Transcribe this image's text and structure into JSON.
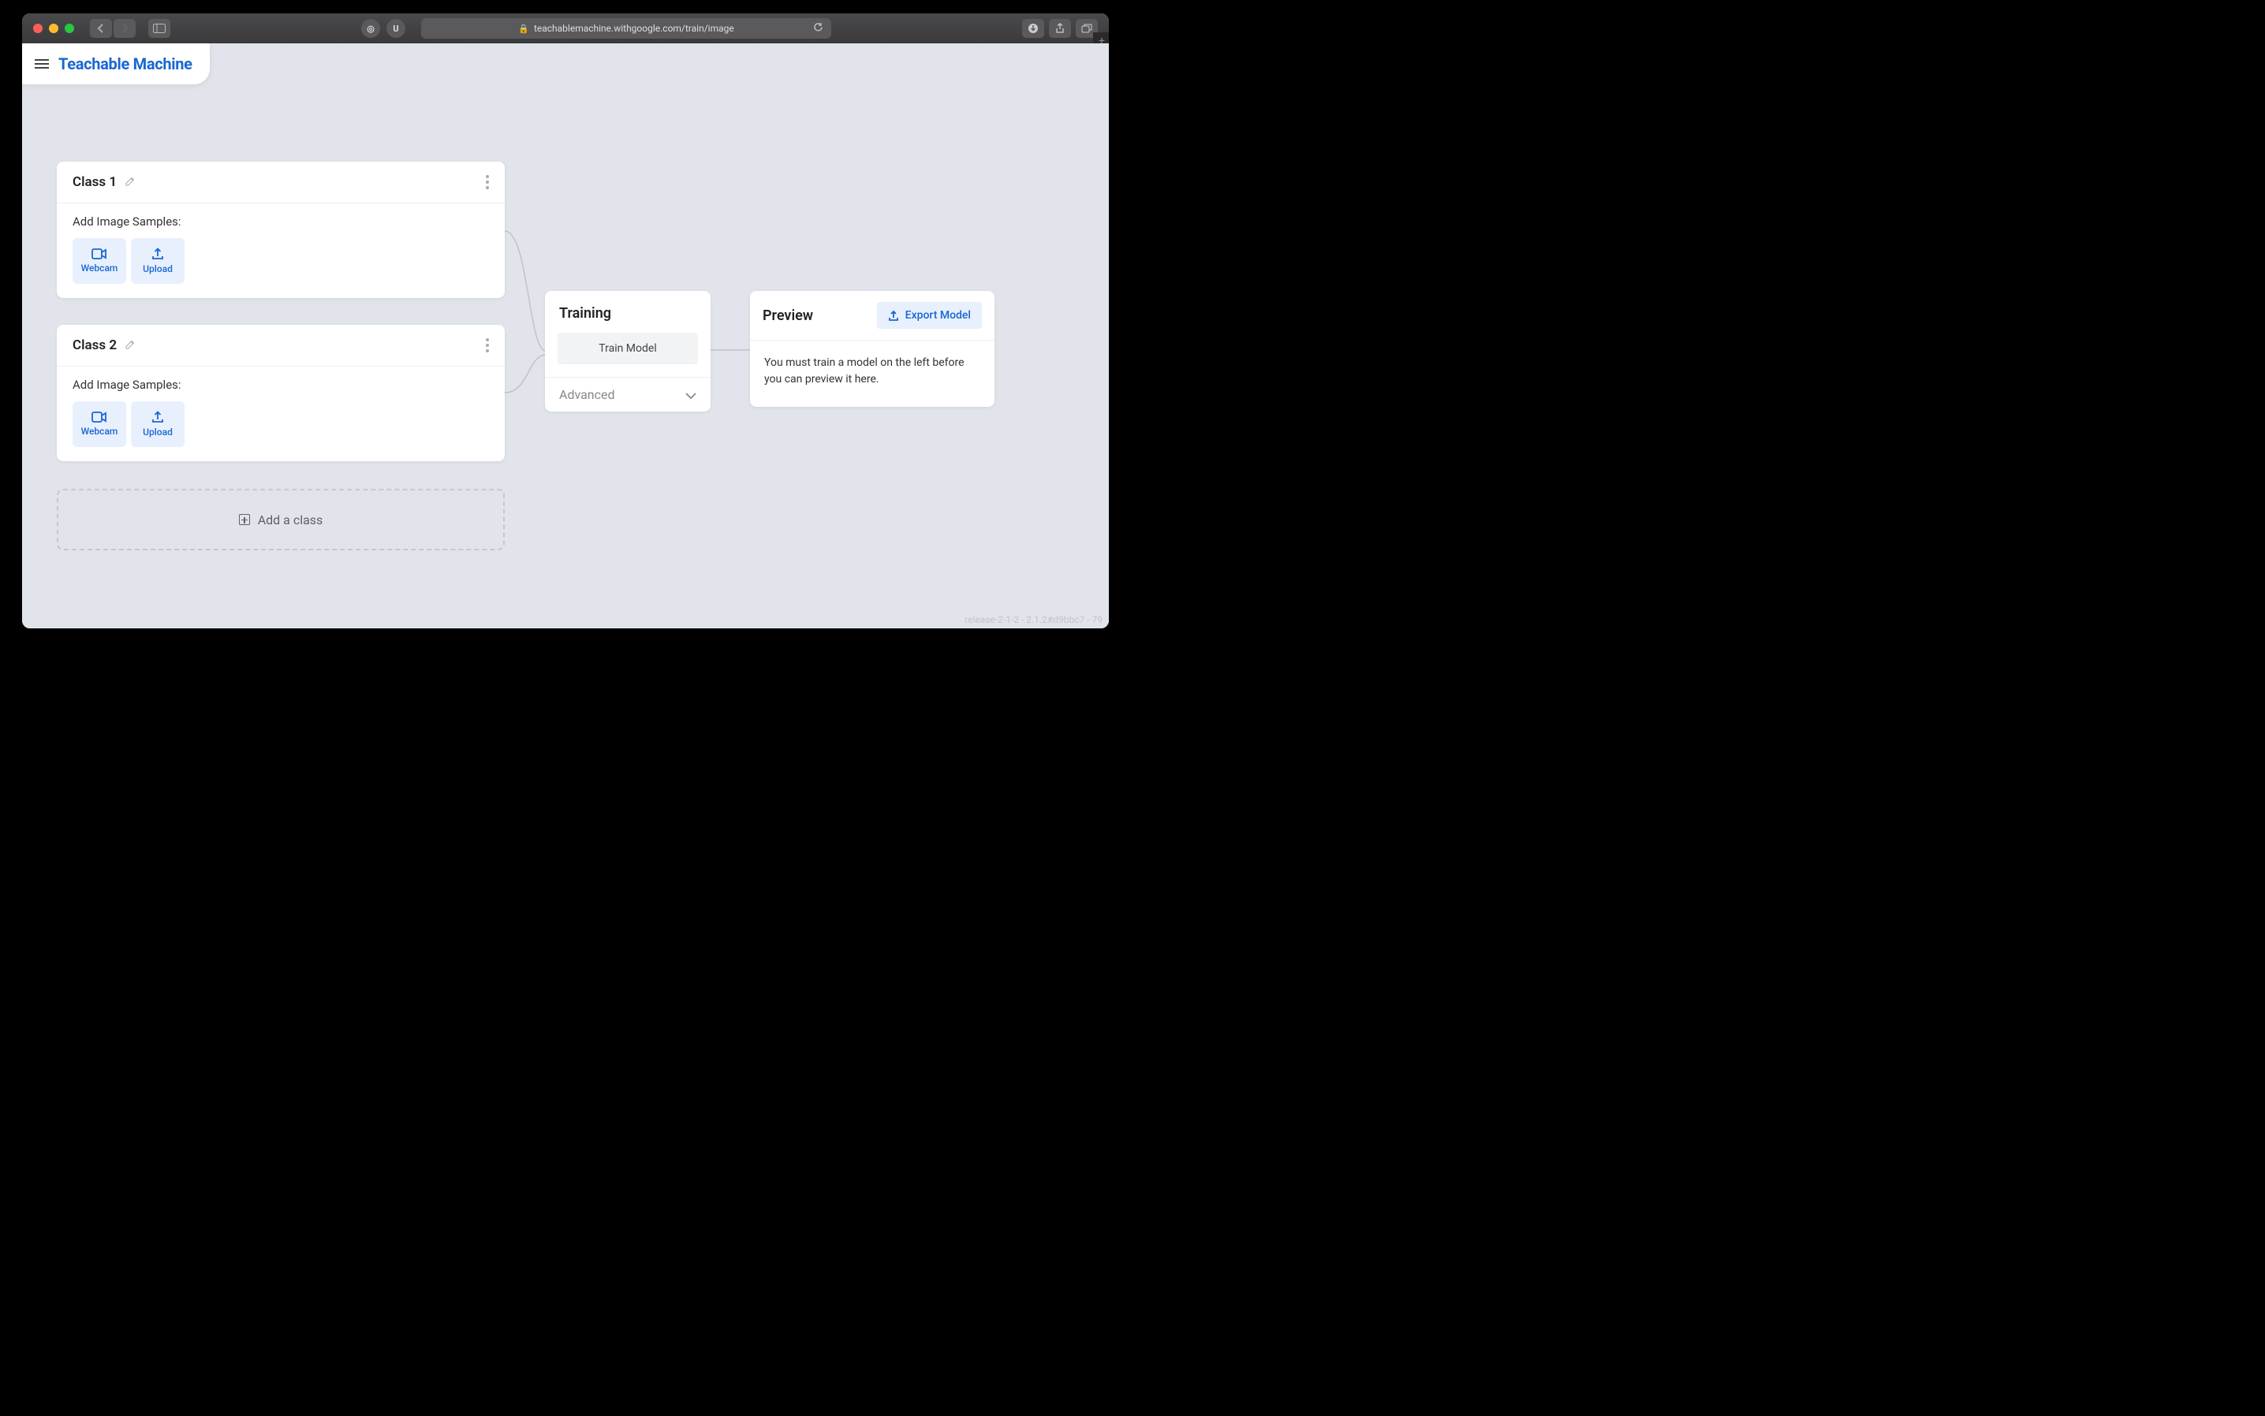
{
  "browser": {
    "url": "teachablemachine.withgoogle.com/train/image"
  },
  "header": {
    "brand": "Teachable Machine"
  },
  "classes": [
    {
      "title": "Class 1",
      "samples_label": "Add Image Samples:",
      "webcam_label": "Webcam",
      "upload_label": "Upload"
    },
    {
      "title": "Class 2",
      "samples_label": "Add Image Samples:",
      "webcam_label": "Webcam",
      "upload_label": "Upload"
    }
  ],
  "add_class_label": "Add a class",
  "training": {
    "title": "Training",
    "train_button": "Train Model",
    "advanced_label": "Advanced"
  },
  "preview": {
    "title": "Preview",
    "export_label": "Export Model",
    "body_text": "You must train a model on the left before you can preview it here."
  },
  "version": "release-2-1-2 - 2.1.2#d9bbc7 - 79"
}
